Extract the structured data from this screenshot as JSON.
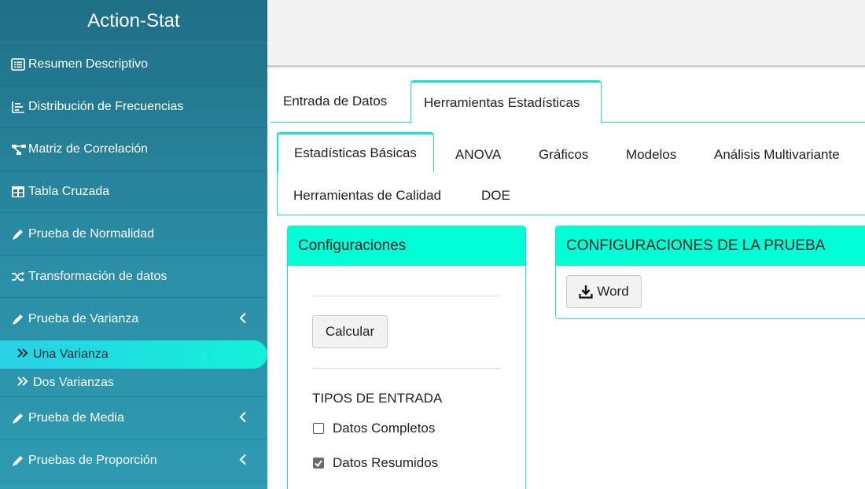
{
  "app": {
    "title": "Action-Stat"
  },
  "sidebar": {
    "items": [
      {
        "label": "Resumen Descriptivo",
        "icon": "list-alt-icon"
      },
      {
        "label": "Distribución de Frecuencias",
        "icon": "bar-list-icon"
      },
      {
        "label": "Matriz de Correlación",
        "icon": "network-icon"
      },
      {
        "label": "Tabla Cruzada",
        "icon": "table-icon"
      },
      {
        "label": "Prueba de Normalidad",
        "icon": "pencil-icon"
      },
      {
        "label": "Transformación de datos",
        "icon": "shuffle-icon"
      },
      {
        "label": "Prueba de Varianza",
        "icon": "pencil-icon",
        "chevron": "chevron-left-icon"
      },
      {
        "label": "Prueba de Media",
        "icon": "pencil-icon",
        "chevron": "chevron-left-icon"
      },
      {
        "label": "Pruebas de Proporción",
        "icon": "pencil-icon",
        "chevron": "chevron-left-icon"
      }
    ],
    "subitems": [
      {
        "label": "Una Varianza",
        "icon": "double-chevron-right-icon",
        "active": true
      },
      {
        "label": "Dos Varianzas",
        "icon": "double-chevron-right-icon",
        "active": false
      }
    ]
  },
  "tabs_main": [
    {
      "label": "Entrada de Datos",
      "active": false
    },
    {
      "label": "Herramientas Estadísticas",
      "active": true
    }
  ],
  "tabs_sub": [
    {
      "label": "Estadísticas Básicas",
      "active": true
    },
    {
      "label": "ANOVA",
      "active": false
    },
    {
      "label": "Gráficos",
      "active": false
    },
    {
      "label": "Modelos",
      "active": false
    },
    {
      "label": "Análisis Multivariante",
      "active": false
    },
    {
      "label": "Herramientas de Calidad",
      "active": false
    },
    {
      "label": "DOE",
      "active": false
    }
  ],
  "config_panel": {
    "title": "Configuraciones",
    "calc_label": "Calcular",
    "input_types_label": "TIPOS DE ENTRADA",
    "options": [
      {
        "label": "Datos Completos",
        "checked": false
      },
      {
        "label": "Datos Resumidos",
        "checked": true
      }
    ]
  },
  "test_panel": {
    "title": "CONFIGURACIONES DE LA PRUEBA",
    "word_label": "Word",
    "word_icon": "download-icon"
  },
  "colors": {
    "accent": "#00ffd6",
    "sidebar": "#1f6f86",
    "active_sub": "#12f2d8"
  }
}
